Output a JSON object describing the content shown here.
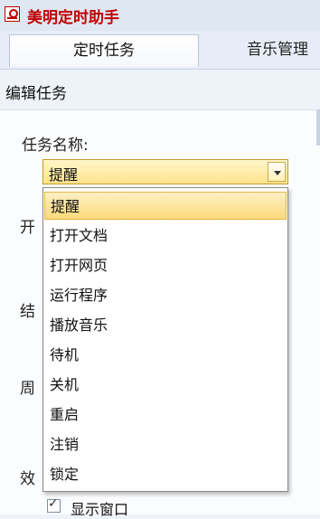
{
  "app": {
    "title": "美明定时助手",
    "icon": "app-logo-icon"
  },
  "tabs": [
    {
      "label": "定时任务",
      "active": true
    },
    {
      "label": "音乐管理",
      "active": false
    }
  ],
  "panel": {
    "title": "编辑任务"
  },
  "form": {
    "task_name_label": "任务名称:",
    "task_name_value": "提醒",
    "start_label_partial": "开",
    "end_label_partial": "结",
    "period_label_partial": "周",
    "effect_label_partial": "效",
    "show_window_label": "显示窗口",
    "show_window_checked": true
  },
  "dropdown": {
    "options": [
      "提醒",
      "打开文档",
      "打开网页",
      "运行程序",
      "播放音乐",
      "待机",
      "关机",
      "重启",
      "注销",
      "锁定"
    ],
    "selected_index": 0
  },
  "colors": {
    "title": "#c00000",
    "highlight": "#fbd97a"
  }
}
